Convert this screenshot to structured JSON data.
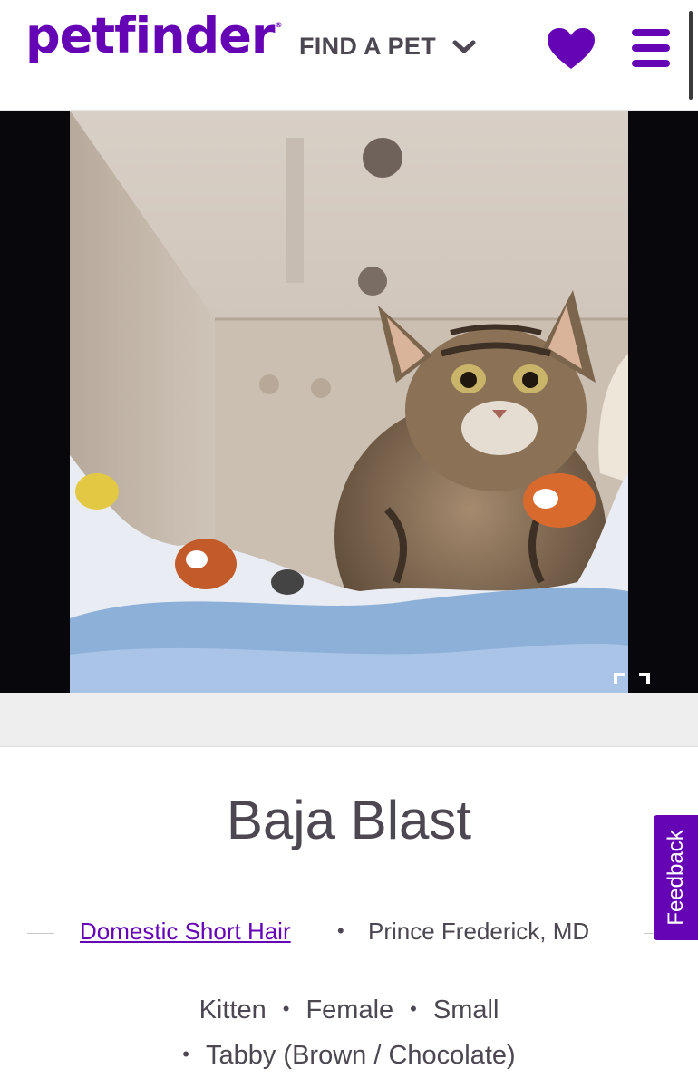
{
  "header": {
    "logo_text": "petfinder",
    "logo_reg": "®",
    "find_pet_label": "FIND A PET",
    "find_pet_icon": "chevron-down-icon",
    "favorites_icon": "heart-icon",
    "menu_icon": "hamburger-menu-icon",
    "brand_color": "#6504b5"
  },
  "gallery": {
    "photo_subject": "tabby kitten photo",
    "expand_icon": "fullscreen-expand-icon"
  },
  "pet": {
    "name": "Baja Blast",
    "breed": "Domestic Short Hair",
    "location": "Prince Frederick, MD",
    "age": "Kitten",
    "sex": "Female",
    "size": "Small",
    "color": "Tabby (Brown / Chocolate)",
    "separator": "•"
  },
  "feedback": {
    "label": "Feedback"
  }
}
